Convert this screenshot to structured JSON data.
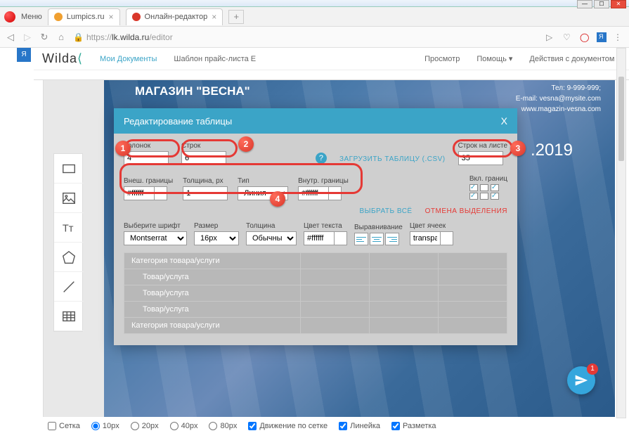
{
  "window": {
    "menu": "Меню"
  },
  "tabs": [
    {
      "title": "Lumpics.ru",
      "icon_color": "#f0a030"
    },
    {
      "title": "Онлайн-редактор",
      "icon_color": "#d9372a"
    }
  ],
  "address": {
    "scheme": "https://",
    "host": "lk.wilda.ru",
    "path": "/editor"
  },
  "wilda": {
    "logo": "Wilda",
    "my_docs": "Мои Документы",
    "template": "Шаблон прайс-листа E",
    "preview": "Просмотр",
    "help": "Помощь",
    "doc_actions": "Действия с документом"
  },
  "document": {
    "title": "МАГАЗИН \"ВЕСНА\"",
    "tel": "Тел: 9-999-999;",
    "email": "E-mail: vesna@mysite.com",
    "web": "www.magazin-vesna.com",
    "year": ".2019"
  },
  "modal": {
    "title": "Редактирование таблицы",
    "close": "X",
    "columns_label": "Колонок",
    "columns_value": "4",
    "rows_label": "Строк",
    "rows_value": "6",
    "load_csv": "ЗАГРУЗИТЬ ТАБЛИЦУ (.CSV)",
    "rows_per_page_label": "Строк на листе",
    "rows_per_page_value": "35",
    "outer_border_label": "Внеш. границы",
    "outer_border_value": "#ffffff",
    "thickness_label": "Толщина, px",
    "thickness_value": "1",
    "type_label": "Тип",
    "type_value": "Линия",
    "inner_border_label": "Внутр. границы",
    "inner_border_value": "#ffffff",
    "enable_borders_label": "Вкл. границ",
    "select_all": "ВЫБРАТЬ ВСЁ",
    "deselect": "ОТМЕНА ВЫДЕЛЕНИЯ",
    "font_label": "Выберите шрифт",
    "font_value": "Montserrat",
    "size_label": "Размер",
    "size_value": "16px",
    "weight_label": "Толщина",
    "weight_value": "Обычный",
    "text_color_label": "Цвет текста",
    "text_color_value": "#ffffff",
    "align_label": "Выравнивание",
    "cell_color_label": "Цвет ячеек",
    "cell_color_value": "transpare",
    "table_rows": [
      "Категория товара/услуги",
      "Товар/услуга",
      "Товар/услуга",
      "Товар/услуга",
      "Категория товара/услуги"
    ]
  },
  "annotations": {
    "b1": "1",
    "b2": "2",
    "b3": "3",
    "b4": "4"
  },
  "status_bar": {
    "grid": "Сетка",
    "g10": "10px",
    "g20": "20px",
    "g40": "40px",
    "g80": "80px",
    "snap": "Движение по сетке",
    "ruler": "Линейка",
    "markup": "Разметка"
  },
  "fab_count": "1"
}
